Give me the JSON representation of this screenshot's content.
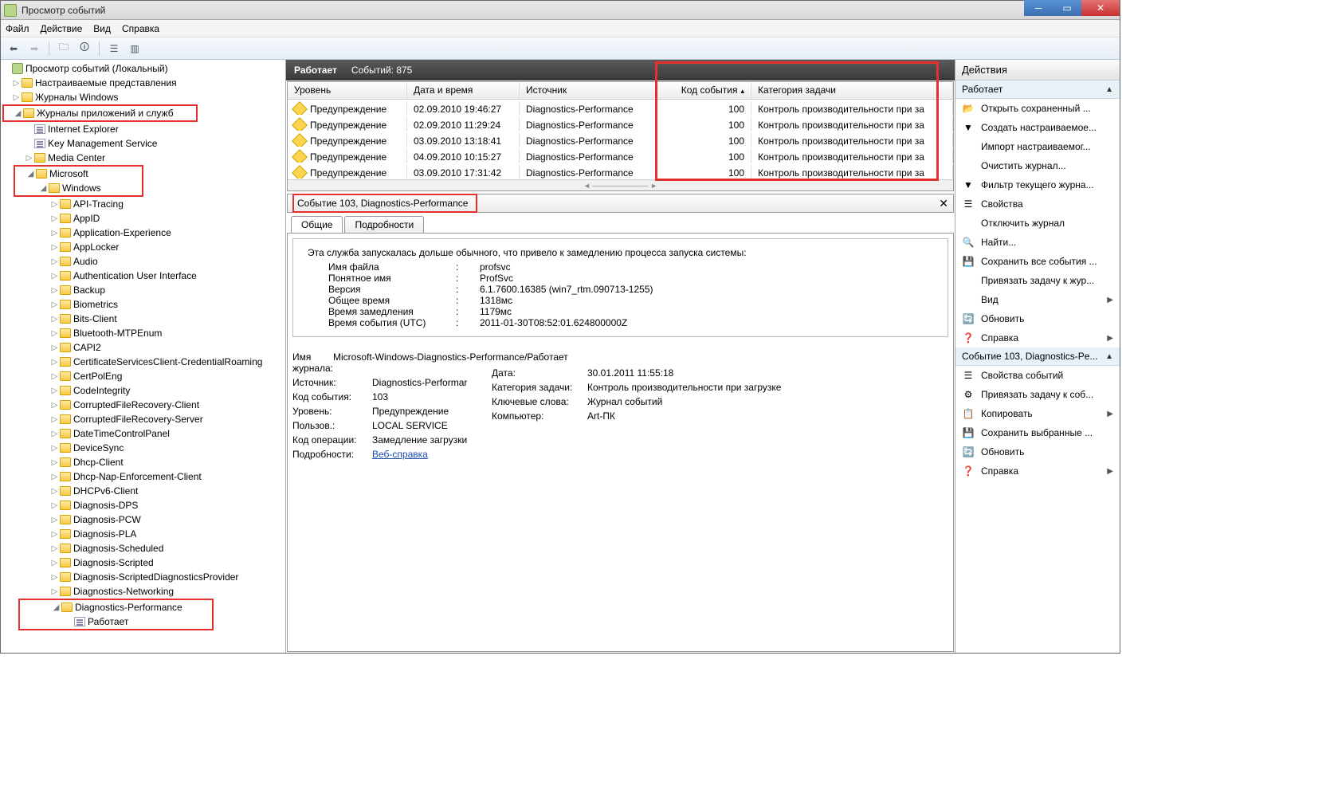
{
  "title": "Просмотр событий",
  "menu": {
    "file": "Файл",
    "action": "Действие",
    "view": "Вид",
    "help": "Справка"
  },
  "tree": {
    "root": "Просмотр событий (Локальный)",
    "custom_views": "Настраиваемые представления",
    "win_logs": "Журналы Windows",
    "app_logs": "Журналы приложений и служб",
    "ie": "Internet Explorer",
    "kms": "Key Management Service",
    "mc": "Media Center",
    "ms": "Microsoft",
    "windows": "Windows",
    "items": [
      "API-Tracing",
      "AppID",
      "Application-Experience",
      "AppLocker",
      "Audio",
      "Authentication User Interface",
      "Backup",
      "Biometrics",
      "Bits-Client",
      "Bluetooth-MTPEnum",
      "CAPI2",
      "CertificateServicesClient-CredentialRoaming",
      "CertPolEng",
      "CodeIntegrity",
      "CorruptedFileRecovery-Client",
      "CorruptedFileRecovery-Server",
      "DateTimeControlPanel",
      "DeviceSync",
      "Dhcp-Client",
      "Dhcp-Nap-Enforcement-Client",
      "DHCPv6-Client",
      "Diagnosis-DPS",
      "Diagnosis-PCW",
      "Diagnosis-PLA",
      "Diagnosis-Scheduled",
      "Diagnosis-Scripted",
      "Diagnosis-ScriptedDiagnosticsProvider",
      "Diagnostics-Networking",
      "Diagnostics-Performance"
    ],
    "operational": "Работает"
  },
  "grid": {
    "status": "Работает",
    "count_label": "Событий: 875",
    "cols": {
      "level": "Уровень",
      "date": "Дата и время",
      "src": "Источник",
      "id": "Код события",
      "cat": "Категория задачи"
    },
    "rows": [
      {
        "level": "Предупреждение",
        "date": "02.09.2010 19:46:27",
        "src": "Diagnostics-Performance",
        "id": "100",
        "cat": "Контроль производительности при за"
      },
      {
        "level": "Предупреждение",
        "date": "02.09.2010 11:29:24",
        "src": "Diagnostics-Performance",
        "id": "100",
        "cat": "Контроль производительности при за"
      },
      {
        "level": "Предупреждение",
        "date": "03.09.2010 13:18:41",
        "src": "Diagnostics-Performance",
        "id": "100",
        "cat": "Контроль производительности при за"
      },
      {
        "level": "Предупреждение",
        "date": "04.09.2010 10:15:27",
        "src": "Diagnostics-Performance",
        "id": "100",
        "cat": "Контроль производительности при за"
      },
      {
        "level": "Предупреждение",
        "date": "03.09.2010 17:31:42",
        "src": "Diagnostics-Performance",
        "id": "100",
        "cat": "Контроль производительности при за"
      }
    ]
  },
  "detail": {
    "header": "Событие 103, Diagnostics-Performance",
    "tabs": {
      "general": "Общие",
      "details": "Подробности"
    },
    "msg": "Эта служба запускалась дольше обычного, что привело к замедлению процесса запуска системы:",
    "fields": [
      {
        "k": "Имя файла",
        "v": "profsvc"
      },
      {
        "k": "Понятное имя",
        "v": "ProfSvc"
      },
      {
        "k": "Версия",
        "v": "6.1.7600.16385 (win7_rtm.090713-1255)"
      },
      {
        "k": "Общее время",
        "v": "1318мс"
      },
      {
        "k": "Время замедления",
        "v": "1179мс"
      },
      {
        "k": "Время события (UTC)",
        "v": "2011-01-30T08:52:01.624800000Z"
      }
    ],
    "left": [
      {
        "k": "Имя журнала:",
        "v": "Microsoft-Windows-Diagnostics-Performance/Работает"
      },
      {
        "k": "Источник:",
        "v": "Diagnostics-Performar"
      },
      {
        "k": "Код события:",
        "v": "103"
      },
      {
        "k": "Уровень:",
        "v": "Предупреждение"
      },
      {
        "k": "Пользов.:",
        "v": "LOCAL SERVICE"
      },
      {
        "k": "Код операции:",
        "v": "Замедление загрузки"
      },
      {
        "k": "Подробности:",
        "v": "Веб-справка",
        "link": true
      }
    ],
    "right": [
      {
        "k": "Дата:",
        "v": "30.01.2011 11:55:18"
      },
      {
        "k": "Категория задачи:",
        "v": "Контроль производительности при загрузке"
      },
      {
        "k": "Ключевые слова:",
        "v": "Журнал событий"
      },
      {
        "k": "Компьютер:",
        "v": "Art-ПК"
      }
    ]
  },
  "actions": {
    "title": "Действия",
    "sec1": "Работает",
    "sec2": "Событие 103, Diagnostics-Pe...",
    "g1": [
      {
        "icon": "open",
        "t": "Открыть сохраненный ..."
      },
      {
        "icon": "filter",
        "t": "Создать настраиваемое..."
      },
      {
        "icon": "",
        "t": "Импорт настраиваемог..."
      },
      {
        "icon": "",
        "t": "Очистить журнал..."
      },
      {
        "icon": "filter",
        "t": "Фильтр текущего журна..."
      },
      {
        "icon": "prop",
        "t": "Свойства"
      },
      {
        "icon": "",
        "t": "Отключить журнал"
      },
      {
        "icon": "find",
        "t": "Найти..."
      },
      {
        "icon": "save",
        "t": "Сохранить все события ..."
      },
      {
        "icon": "",
        "t": "Привязать задачу к жур..."
      },
      {
        "icon": "",
        "t": "Вид",
        "arrow": true
      },
      {
        "icon": "refresh",
        "t": "Обновить"
      },
      {
        "icon": "help",
        "t": "Справка",
        "arrow": true
      }
    ],
    "g2": [
      {
        "icon": "prop",
        "t": "Свойства событий"
      },
      {
        "icon": "task",
        "t": "Привязать задачу к соб..."
      },
      {
        "icon": "copy",
        "t": "Копировать",
        "arrow": true
      },
      {
        "icon": "save",
        "t": "Сохранить выбранные ..."
      },
      {
        "icon": "refresh",
        "t": "Обновить"
      },
      {
        "icon": "help",
        "t": "Справка",
        "arrow": true
      }
    ]
  }
}
